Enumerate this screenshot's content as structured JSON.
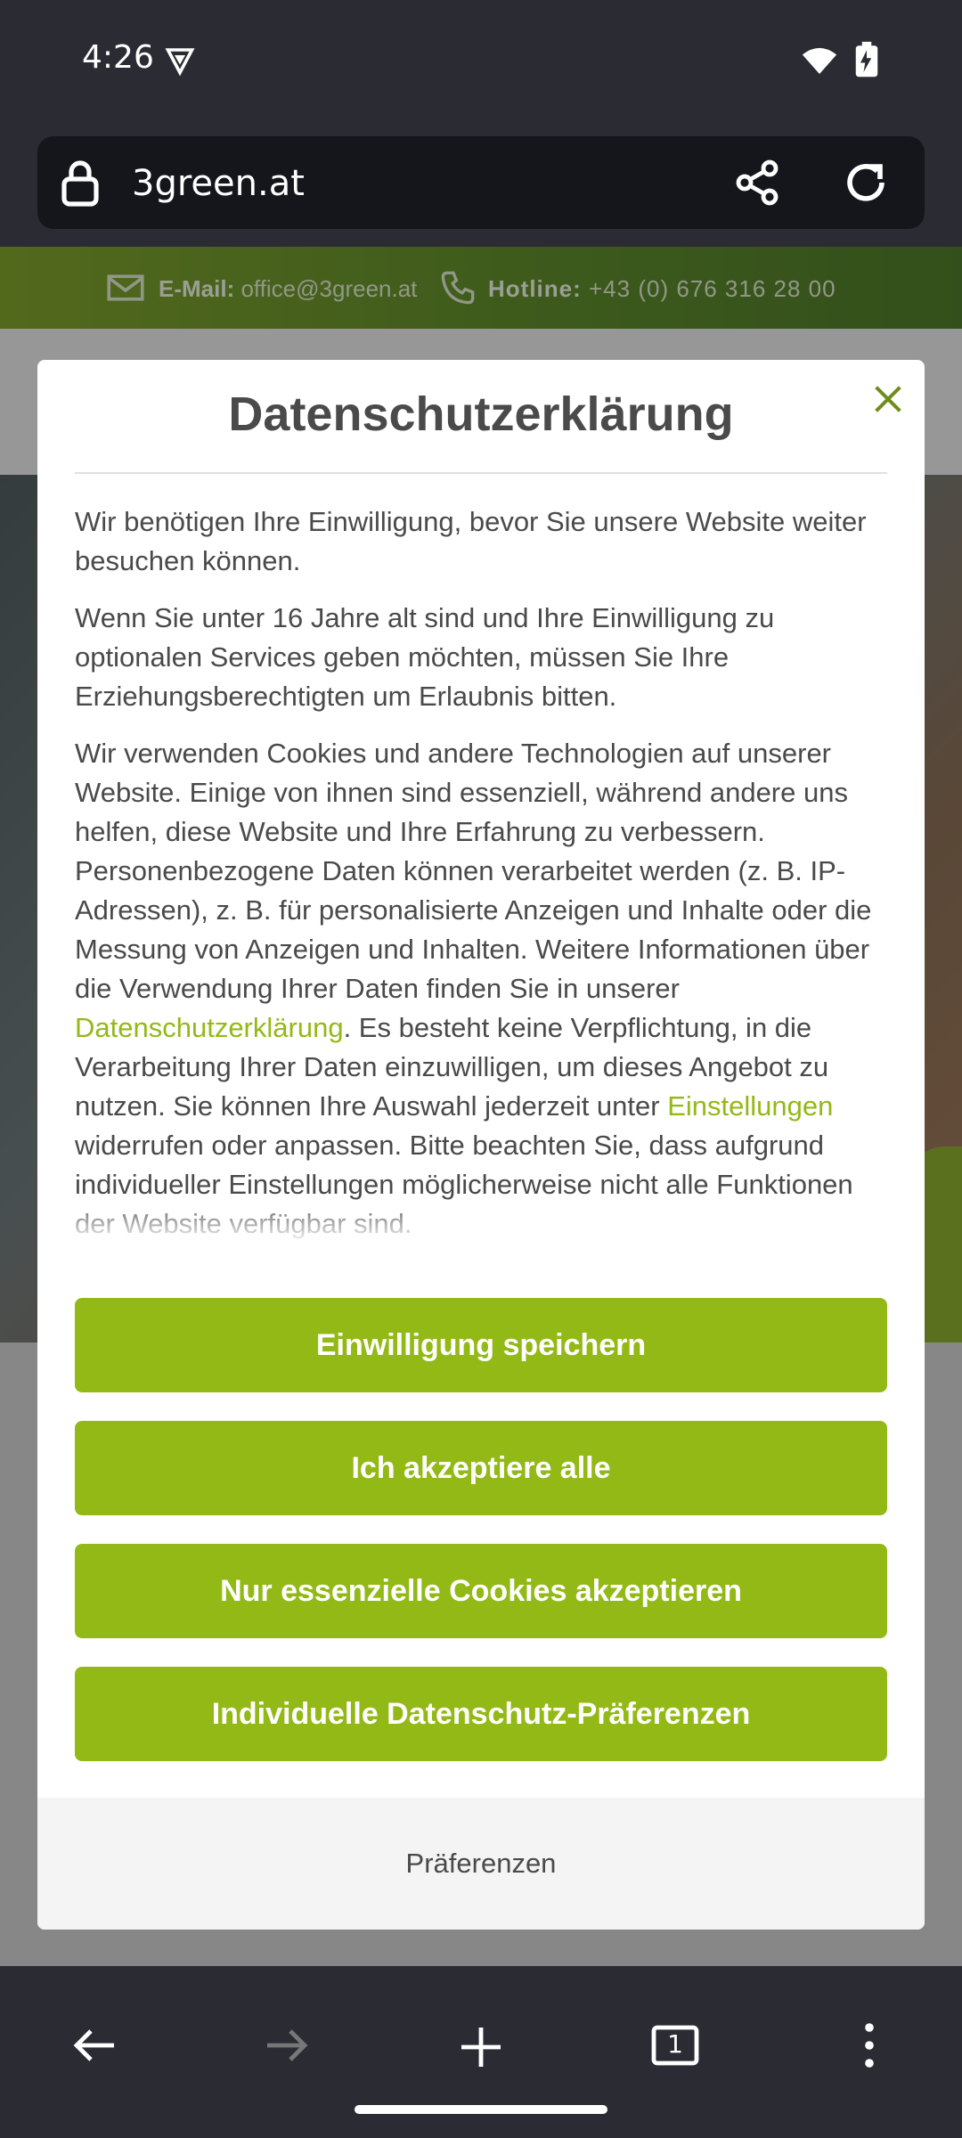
{
  "status_bar": {
    "time": "4:26"
  },
  "browser": {
    "url": "3green.at",
    "tab_count": "1"
  },
  "page": {
    "email_label": "E-Mail:",
    "email_value": "office@3green.at",
    "hotline_label": "Hotline:",
    "hotline_value": "+43 (0) 676 316 28 00"
  },
  "modal": {
    "title": "Datenschutzerklärung",
    "p1": "Wir benötigen Ihre Einwilligung, bevor Sie unsere Website weiter besuchen können.",
    "p2": "Wenn Sie unter 16 Jahre alt sind und Ihre Einwilligung zu optionalen Services geben möchten, müssen Sie Ihre Erziehungsberechtigten um Erlaubnis bitten.",
    "p3_a": "Wir verwenden Cookies und andere Technologien auf unserer Website. Einige von ihnen sind essenziell, während andere uns helfen, diese Website und Ihre Erfahrung zu verbessern. Personenbezogene Daten können verarbeitet werden (z. B. IP-Adressen), z. B. für personalisierte Anzeigen und Inhalte oder die Messung von Anzeigen und Inhalten. Weitere Informationen über die Verwendung Ihrer Daten finden Sie in unserer ",
    "p3_link1": "Datenschutzerklärung",
    "p3_b": ". Es besteht keine Verpflichtung, in die Verarbeitung Ihrer Daten einzuwilligen, um dieses Angebot zu nutzen. Sie können Ihre Auswahl jederzeit unter ",
    "p3_link2": "Einstellungen",
    "p3_c": " widerrufen oder anpassen. Bitte beachten Sie, dass aufgrund individueller Einstellungen möglicherweise nicht alle Funktionen der Website verfügbar sind.",
    "btn_save": "Einwilligung speichern",
    "btn_accept_all": "Ich akzeptiere alle",
    "btn_essential": "Nur essenzielle Cookies akzeptieren",
    "btn_individual": "Individuelle Datenschutz-Präferenzen",
    "footer_link": "Präferenzen"
  },
  "colors": {
    "accent": "#93b917",
    "browser_dark": "#2b2c33"
  },
  "icons": [
    "vpn-icon",
    "wifi-icon",
    "battery-icon",
    "lock-icon",
    "share-icon",
    "reload-icon",
    "mail-icon",
    "phone-icon",
    "close-icon",
    "back-icon",
    "forward-icon",
    "new-tab-icon",
    "tabs-icon",
    "menu-icon"
  ]
}
